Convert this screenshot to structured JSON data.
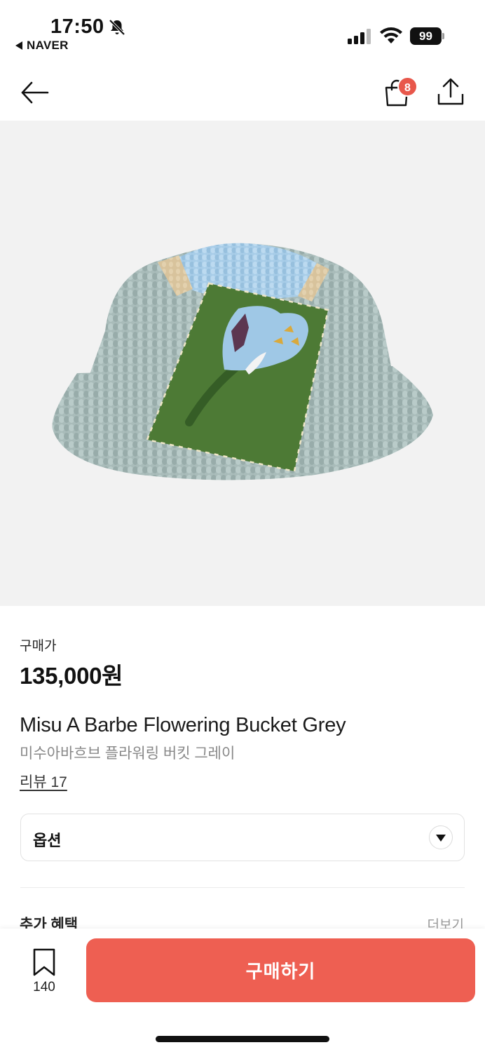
{
  "status_bar": {
    "time": "17:50",
    "back_app": "NAVER",
    "battery": "99"
  },
  "header": {
    "cart_badge": "8",
    "icons": [
      "back-arrow-icon",
      "shopping-bag-icon",
      "share-icon"
    ]
  },
  "product": {
    "image_alt": "Misu A Barbe Flowering Bucket Grey",
    "price_label": "구매가",
    "price": "135,000원",
    "name_en": "Misu A Barbe Flowering Bucket Grey",
    "name_ko": "미수아바흐브 플라워링 버킷 그레이",
    "review": "리뷰 17"
  },
  "option": {
    "label": "옵션"
  },
  "benefits": {
    "title": "추가 혜택",
    "more": "더보기"
  },
  "bottom_bar": {
    "wish_count": "140",
    "buy_label": "구매하기"
  },
  "colors": {
    "accent": "#ee5f52",
    "badge": "#e8574b",
    "image_bg": "#f2f2f2"
  }
}
